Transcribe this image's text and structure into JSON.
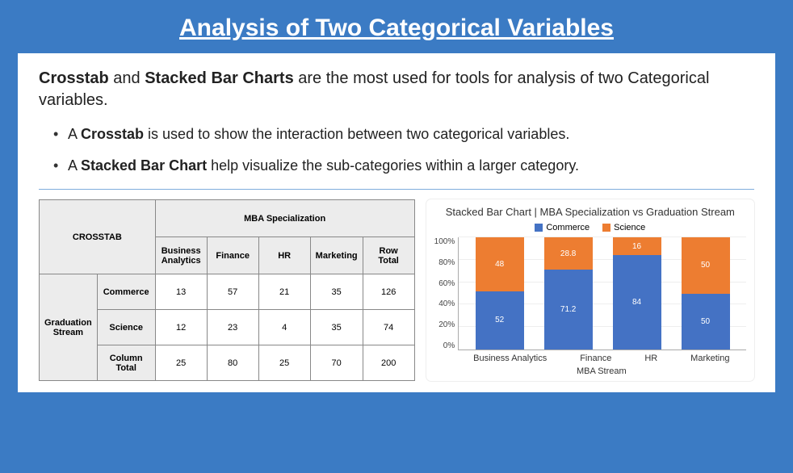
{
  "title": "Analysis of Two Categorical Variables",
  "intro": {
    "pre": "Crosstab",
    "mid": " and ",
    "strong2": "Stacked Bar Charts",
    "rest": " are the most used for tools for analysis of two Categorical variables."
  },
  "bullets": [
    {
      "pre": "A ",
      "strong": "Crosstab",
      "rest": " is used to show the interaction between two categorical variables."
    },
    {
      "pre": "A ",
      "strong": "Stacked Bar Chart",
      "rest": " help visualize the sub-categories within a larger category."
    }
  ],
  "crosstab": {
    "corner": "CROSSTAB",
    "colgroup": "MBA Specialization",
    "rowgroup": "Graduation Stream",
    "cols": [
      "Business Analytics",
      "Finance",
      "HR",
      "Marketing",
      "Row Total"
    ],
    "rows": [
      {
        "label": "Commerce",
        "cells": [
          "13",
          "57",
          "21",
          "35",
          "126"
        ]
      },
      {
        "label": "Science",
        "cells": [
          "12",
          "23",
          "4",
          "35",
          "74"
        ]
      },
      {
        "label": "Column Total",
        "cells": [
          "25",
          "80",
          "25",
          "70",
          "200"
        ]
      }
    ]
  },
  "chart": {
    "title": "Stacked Bar Chart | MBA Specialization vs Graduation Stream",
    "legend": {
      "commerce": "Commerce",
      "science": "Science"
    },
    "yticks": [
      "100%",
      "80%",
      "60%",
      "40%",
      "20%",
      "0%"
    ],
    "xlabel": "MBA Stream",
    "categories": [
      "Business Analytics",
      "Finance",
      "HR",
      "Marketing"
    ],
    "labels": {
      "commerce": [
        "52",
        "71.2",
        "84",
        "50"
      ],
      "science": [
        "48",
        "28.8",
        "16",
        "50"
      ]
    }
  },
  "chart_data": {
    "type": "bar",
    "stacked": true,
    "normalized_percent": true,
    "title": "Stacked Bar Chart | MBA Specialization vs Graduation Stream",
    "xlabel": "MBA Stream",
    "ylabel": "",
    "ylim": [
      0,
      100
    ],
    "yticks": [
      0,
      20,
      40,
      60,
      80,
      100
    ],
    "categories": [
      "Business Analytics",
      "Finance",
      "HR",
      "Marketing"
    ],
    "series": [
      {
        "name": "Commerce",
        "color": "#4472c4",
        "values": [
          52,
          71.2,
          84,
          50
        ]
      },
      {
        "name": "Science",
        "color": "#ed7d31",
        "values": [
          48,
          28.8,
          16,
          50
        ]
      }
    ],
    "legend_position": "top"
  }
}
